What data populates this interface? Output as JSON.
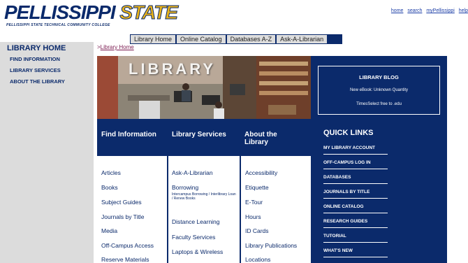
{
  "header": {
    "logo_primary": "PELLISSIPPI",
    "logo_secondary": "STATE",
    "logo_tagline": "PELLISSIPPI STATE TECHNICAL COMMUNITY COLLEGE",
    "links": [
      "home",
      "search",
      "myPellissippi",
      "help"
    ]
  },
  "tabs": [
    "Library Home",
    "Online Catalog",
    "Databases A-Z",
    "Ask-A-Librarian"
  ],
  "sidebar": {
    "title": "LIBRARY HOME",
    "items": [
      "FIND INFORMATION",
      "LIBRARY SERVICES",
      "ABOUT THE LIBRARY"
    ]
  },
  "breadcrumb": {
    "prefix": ">",
    "label": "Library Home"
  },
  "banner": {
    "word": "LIBRARY"
  },
  "blog": {
    "title": "LIBRARY BLOG",
    "items": [
      "New eBook: Unknown Quantity",
      "TimesSelect free to .edu"
    ]
  },
  "columns": {
    "find": {
      "title": "Find Information",
      "links": [
        "Articles",
        "Books",
        "Subject Guides",
        "Journals by Title",
        "Media",
        "Off-Campus Access",
        "Reserve Materials"
      ]
    },
    "services": {
      "title": "Library Services",
      "links": [
        "Ask-A-Librarian",
        "Borrowing",
        "Distance Learning",
        "Faculty Services",
        "Laptops & Wireless"
      ],
      "borrowing_sub": "Intercampus Borrowing / Interlibrary Loan / Renew Books"
    },
    "about": {
      "title_line1": "About the",
      "title_line2": "Library",
      "links": [
        "Accessibility",
        "Etiquette",
        "E-Tour",
        "Hours",
        "ID Cards",
        "Library Publications",
        "Locations"
      ]
    }
  },
  "quick_links": {
    "title": "QUICK LINKS",
    "items": [
      "MY LIBRARY ACCOUNT",
      "OFF-CAMPUS LOG IN",
      "DATABASES",
      "JOURNALS BY TITLE",
      "ONLINE CATALOG",
      "RESEARCH GUIDES",
      "TUTORIAL",
      "WHAT'S NEW"
    ]
  },
  "colors": {
    "navy": "#0b2a6b",
    "gold": "#e8b21a",
    "sidebar_gray": "#dcdcdc",
    "crumb": "#7a1a50"
  }
}
